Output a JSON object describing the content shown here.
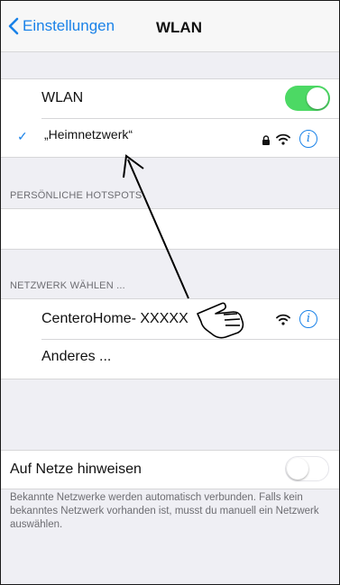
{
  "nav": {
    "back_label": "Einstellungen",
    "title": "WLAN"
  },
  "wifi": {
    "label": "WLAN",
    "enabled": true,
    "connected_network": "„Heimnetzwerk“",
    "connected_checkmark": "✓"
  },
  "hotspots": {
    "header": "PERSÖNLICHE HOTSPOTS"
  },
  "networks": {
    "header": "NETZWERK WÄHLEN ...",
    "items": [
      {
        "name": "CenteroHome- XXXXX"
      }
    ],
    "other_label": "Anderes ..."
  },
  "ask_to_join": {
    "label": "Auf Netze hinweisen",
    "enabled": false,
    "description": "Bekannte Netzwerke werden automatisch verbunden. Falls kein bekanntes Netzwerk vorhanden ist, musst du manuell ein Netzwerk auswählen."
  },
  "colors": {
    "accent": "#1a82e8",
    "switch_on": "#4cd964",
    "switch_off_border": "#e5e5ea"
  },
  "icons": {
    "back": "chevron-left-icon",
    "lock": "lock-icon",
    "wifi": "wifi-icon",
    "info": "info-icon",
    "hand": "pointing-hand-icon",
    "arrow": "arrow-annotation"
  }
}
